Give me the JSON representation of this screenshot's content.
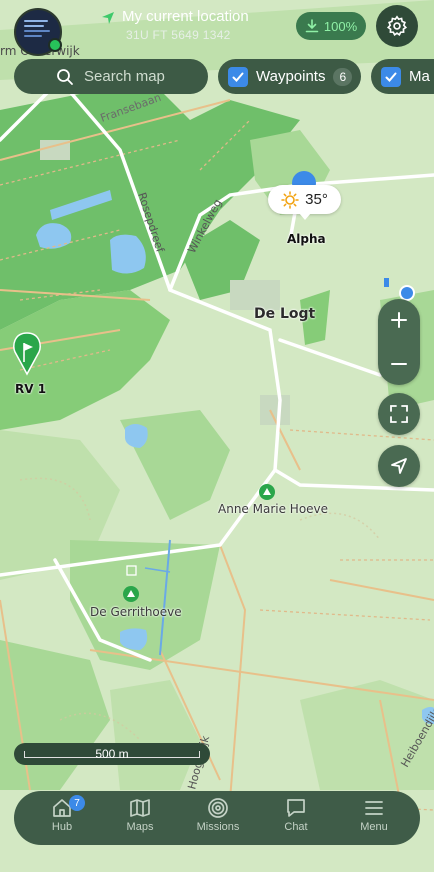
{
  "header": {
    "location_title": "My current location",
    "location_coords": "31U FT 5649 1342",
    "download_label": "100%"
  },
  "search": {
    "placeholder": "Search map"
  },
  "filters": [
    {
      "label": "Waypoints",
      "count": "6"
    },
    {
      "label": "Ma"
    }
  ],
  "map": {
    "place_names": {
      "oisterwijk": "rm Oisterwijk",
      "de_logt": "De Logt",
      "alpha": "Alpha",
      "rv1": "RV 1",
      "anne_marie": "Anne Marie Hoeve",
      "gerrithoeve": "De Gerrithoeve",
      "winkelweg": "Winkelweg",
      "rosepdreef": "Rosepdreef",
      "fransebaan": "Fransebaan",
      "heiboendijk": "Heiboendijk",
      "hoogedijk": "Hoogedijk"
    },
    "weather": {
      "temperature": "35°",
      "icon": "sun-icon"
    },
    "scale_label": "500 m"
  },
  "bottom_nav": {
    "items": [
      {
        "label": "Hub",
        "icon": "home-icon",
        "badge": "7"
      },
      {
        "label": "Maps",
        "icon": "map-icon"
      },
      {
        "label": "Missions",
        "icon": "target-icon"
      },
      {
        "label": "Chat",
        "icon": "chat-icon"
      },
      {
        "label": "Menu",
        "icon": "menu-icon"
      }
    ]
  },
  "colors": {
    "accent": "#3c8ae8",
    "waypoint_green": "#2aa64a",
    "panel": "#3d5a45"
  }
}
